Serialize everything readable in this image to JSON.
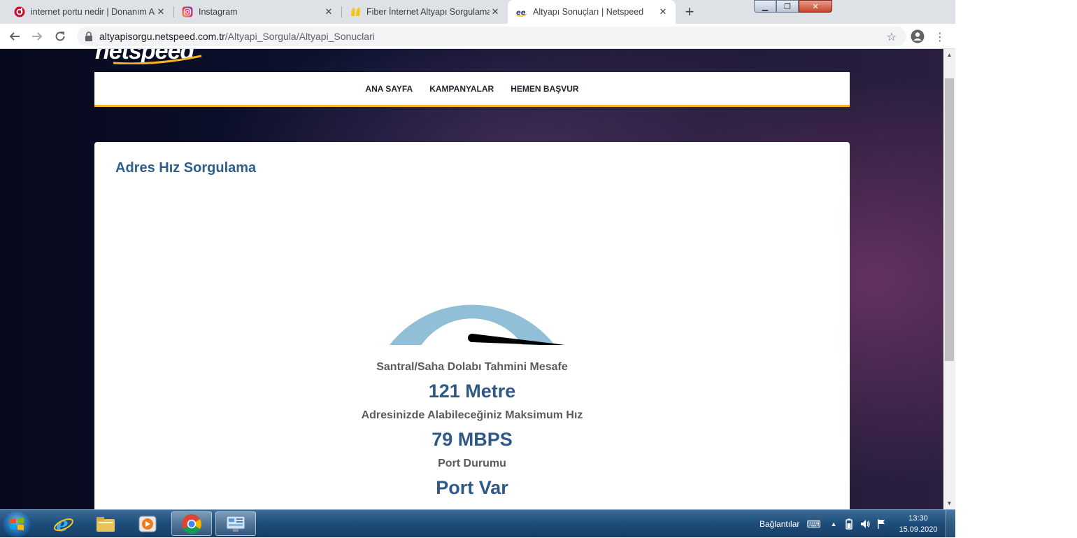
{
  "browser": {
    "tabs": [
      {
        "title": "internet portu nedir | Donanım Arşivi",
        "favicon": "donanimarsivi-icon",
        "active": false
      },
      {
        "title": "Instagram",
        "favicon": "instagram-icon",
        "active": false
      },
      {
        "title": "Fiber İnternet Altyapı Sorgulama",
        "favicon": "fiber-icon",
        "active": false
      },
      {
        "title": "Altyapı Sonuçları | Netspeed",
        "favicon": "netspeed-icon",
        "active": true
      }
    ],
    "new_tab": "+",
    "url_host": "altyapisorgu.netspeed.com.tr",
    "url_path": "/Altyapi_Sorgula/Altyapi_Sonuclari",
    "window_buttons": {
      "minimize": "▁",
      "maximize": "❐",
      "close": "✕"
    }
  },
  "page": {
    "logo_text": "netspeed",
    "nav": [
      "ANA SAYFA",
      "KAMPANYALAR",
      "HEMEN BAŞVUR"
    ],
    "card_title": "Adres Hız Sorgulama",
    "gauge": {
      "fraction": 0.93,
      "arc_color": "#90bfd7",
      "needle_color": "#000000"
    },
    "results": [
      {
        "label": "Santral/Saha Dolabı Tahmini Mesafe",
        "value": "121 Metre"
      },
      {
        "label": "Adresinizde Alabileceğiniz Maksimum Hız",
        "value": "79 MBPS"
      },
      {
        "label": "Port Durumu",
        "value": "Port Var"
      }
    ]
  },
  "taskbar": {
    "links_label": "Bağlantılar",
    "time": "13:30",
    "date": "15.09.2020"
  },
  "colors": {
    "accent": "#f5b324",
    "title_blue": "#2f5f8a",
    "value_blue": "#2f5888"
  }
}
